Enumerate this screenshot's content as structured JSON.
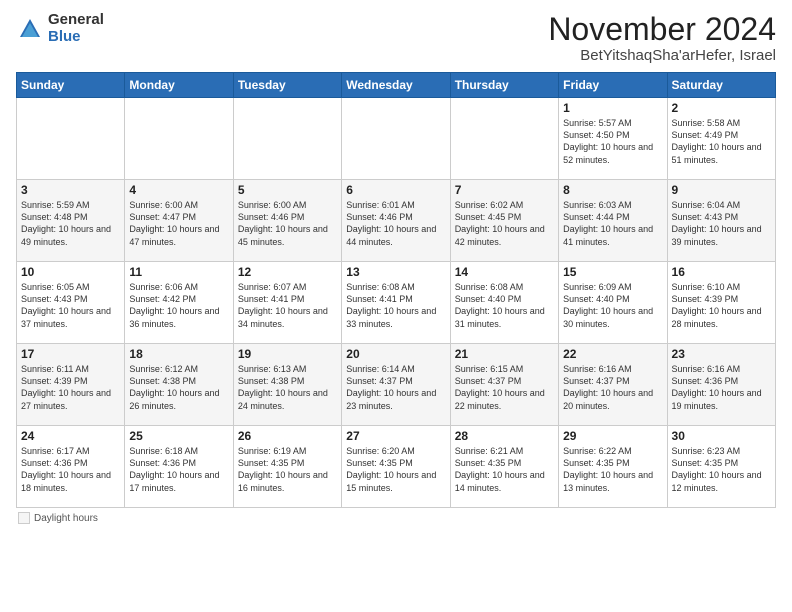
{
  "header": {
    "logo_general": "General",
    "logo_blue": "Blue",
    "month_year": "November 2024",
    "location": "BetYitshaqSha'arHefer, Israel"
  },
  "days_of_week": [
    "Sunday",
    "Monday",
    "Tuesday",
    "Wednesday",
    "Thursday",
    "Friday",
    "Saturday"
  ],
  "weeks": [
    [
      {
        "day": "",
        "detail": ""
      },
      {
        "day": "",
        "detail": ""
      },
      {
        "day": "",
        "detail": ""
      },
      {
        "day": "",
        "detail": ""
      },
      {
        "day": "",
        "detail": ""
      },
      {
        "day": "1",
        "detail": "Sunrise: 5:57 AM\nSunset: 4:50 PM\nDaylight: 10 hours\nand 52 minutes."
      },
      {
        "day": "2",
        "detail": "Sunrise: 5:58 AM\nSunset: 4:49 PM\nDaylight: 10 hours\nand 51 minutes."
      }
    ],
    [
      {
        "day": "3",
        "detail": "Sunrise: 5:59 AM\nSunset: 4:48 PM\nDaylight: 10 hours\nand 49 minutes."
      },
      {
        "day": "4",
        "detail": "Sunrise: 6:00 AM\nSunset: 4:47 PM\nDaylight: 10 hours\nand 47 minutes."
      },
      {
        "day": "5",
        "detail": "Sunrise: 6:00 AM\nSunset: 4:46 PM\nDaylight: 10 hours\nand 45 minutes."
      },
      {
        "day": "6",
        "detail": "Sunrise: 6:01 AM\nSunset: 4:46 PM\nDaylight: 10 hours\nand 44 minutes."
      },
      {
        "day": "7",
        "detail": "Sunrise: 6:02 AM\nSunset: 4:45 PM\nDaylight: 10 hours\nand 42 minutes."
      },
      {
        "day": "8",
        "detail": "Sunrise: 6:03 AM\nSunset: 4:44 PM\nDaylight: 10 hours\nand 41 minutes."
      },
      {
        "day": "9",
        "detail": "Sunrise: 6:04 AM\nSunset: 4:43 PM\nDaylight: 10 hours\nand 39 minutes."
      }
    ],
    [
      {
        "day": "10",
        "detail": "Sunrise: 6:05 AM\nSunset: 4:43 PM\nDaylight: 10 hours\nand 37 minutes."
      },
      {
        "day": "11",
        "detail": "Sunrise: 6:06 AM\nSunset: 4:42 PM\nDaylight: 10 hours\nand 36 minutes."
      },
      {
        "day": "12",
        "detail": "Sunrise: 6:07 AM\nSunset: 4:41 PM\nDaylight: 10 hours\nand 34 minutes."
      },
      {
        "day": "13",
        "detail": "Sunrise: 6:08 AM\nSunset: 4:41 PM\nDaylight: 10 hours\nand 33 minutes."
      },
      {
        "day": "14",
        "detail": "Sunrise: 6:08 AM\nSunset: 4:40 PM\nDaylight: 10 hours\nand 31 minutes."
      },
      {
        "day": "15",
        "detail": "Sunrise: 6:09 AM\nSunset: 4:40 PM\nDaylight: 10 hours\nand 30 minutes."
      },
      {
        "day": "16",
        "detail": "Sunrise: 6:10 AM\nSunset: 4:39 PM\nDaylight: 10 hours\nand 28 minutes."
      }
    ],
    [
      {
        "day": "17",
        "detail": "Sunrise: 6:11 AM\nSunset: 4:39 PM\nDaylight: 10 hours\nand 27 minutes."
      },
      {
        "day": "18",
        "detail": "Sunrise: 6:12 AM\nSunset: 4:38 PM\nDaylight: 10 hours\nand 26 minutes."
      },
      {
        "day": "19",
        "detail": "Sunrise: 6:13 AM\nSunset: 4:38 PM\nDaylight: 10 hours\nand 24 minutes."
      },
      {
        "day": "20",
        "detail": "Sunrise: 6:14 AM\nSunset: 4:37 PM\nDaylight: 10 hours\nand 23 minutes."
      },
      {
        "day": "21",
        "detail": "Sunrise: 6:15 AM\nSunset: 4:37 PM\nDaylight: 10 hours\nand 22 minutes."
      },
      {
        "day": "22",
        "detail": "Sunrise: 6:16 AM\nSunset: 4:37 PM\nDaylight: 10 hours\nand 20 minutes."
      },
      {
        "day": "23",
        "detail": "Sunrise: 6:16 AM\nSunset: 4:36 PM\nDaylight: 10 hours\nand 19 minutes."
      }
    ],
    [
      {
        "day": "24",
        "detail": "Sunrise: 6:17 AM\nSunset: 4:36 PM\nDaylight: 10 hours\nand 18 minutes."
      },
      {
        "day": "25",
        "detail": "Sunrise: 6:18 AM\nSunset: 4:36 PM\nDaylight: 10 hours\nand 17 minutes."
      },
      {
        "day": "26",
        "detail": "Sunrise: 6:19 AM\nSunset: 4:35 PM\nDaylight: 10 hours\nand 16 minutes."
      },
      {
        "day": "27",
        "detail": "Sunrise: 6:20 AM\nSunset: 4:35 PM\nDaylight: 10 hours\nand 15 minutes."
      },
      {
        "day": "28",
        "detail": "Sunrise: 6:21 AM\nSunset: 4:35 PM\nDaylight: 10 hours\nand 14 minutes."
      },
      {
        "day": "29",
        "detail": "Sunrise: 6:22 AM\nSunset: 4:35 PM\nDaylight: 10 hours\nand 13 minutes."
      },
      {
        "day": "30",
        "detail": "Sunrise: 6:23 AM\nSunset: 4:35 PM\nDaylight: 10 hours\nand 12 minutes."
      }
    ]
  ],
  "footer": {
    "legend_label": "Daylight hours"
  }
}
